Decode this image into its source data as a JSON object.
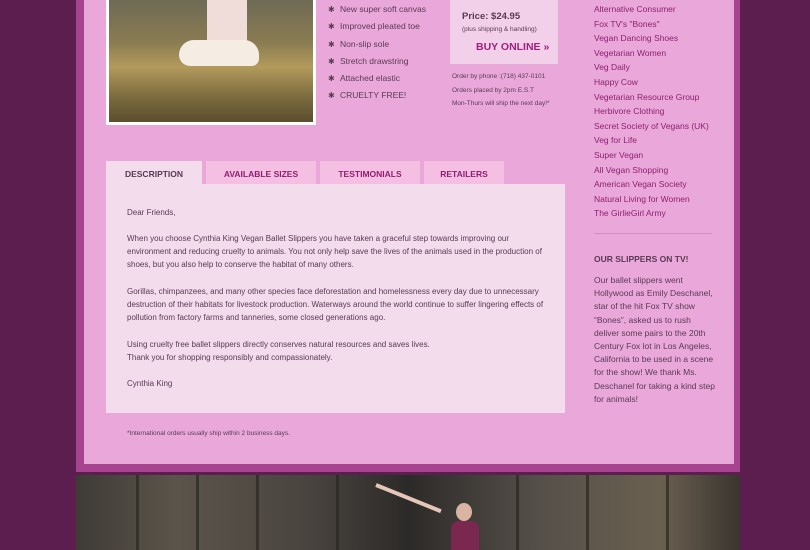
{
  "features": [
    "New super soft canvas",
    "Improved pleated toe",
    "Non-slip sole",
    "Stretch drawstring",
    "Attached elastic",
    "CRUELTY FREE!"
  ],
  "purchase": {
    "price": "Price: $24.95",
    "shipping": "(plus shipping & handling)",
    "buy_label": "BUY ONLINE »",
    "order_phone": "Order by phone :(718) 437-0101",
    "order_time": "Orders placed by 2pm E.S.T",
    "ship_days": "Mon-Thurs will ship the next day!*"
  },
  "sidebar": {
    "links": [
      "Alternative Consumer",
      "Fox TV's \"Bones\"",
      "Vegan Dancing Shoes",
      "Vegetarian Women",
      "Veg Daily",
      "Happy Cow",
      "Vegetarian Resource Group",
      "Herbivore Clothing",
      "Secret Society of Vegans (UK)",
      "Veg for Life",
      "Super Vegan",
      "All Vegan Shopping",
      "American Vegan Society",
      "Natural Living for Women",
      "The GirlieGirl Army"
    ],
    "tv_title": "OUR SLIPPERS ON TV!",
    "tv_text": "Our ballet slippers went Hollywood as Emily Deschanel, star of the hit Fox TV show “Bones”, asked us to rush deliver some pairs to the 20th Century Fox lot in Los Angeles, California to be used in a scene for the show!  We thank Ms. Deschanel for taking a kind step for animals!"
  },
  "tabs": [
    "DESCRIPTION",
    "AVAILABLE SIZES",
    "TESTIMONIALS",
    "RETAILERS"
  ],
  "description": {
    "greeting": "Dear Friends,",
    "para1": "When you choose Cynthia King Vegan Ballet Slippers you have taken a graceful step towards improving our environment and reducing cruelty to animals. You not only help save the lives of the animals used in the production of shoes, but you also help to conserve the habitat of many others.",
    "para2": "Gorillas, chimpanzees, and many other species face deforestation and homelessness every day due to unnecessary destruction of their habitats for livestock production. Waterways around the world continue to suffer lingering effects of pollution from factory farms and tanneries, some closed generations ago.",
    "para3a": "Using cruelty free ballet slippers directly conserves natural resources and saves lives.",
    "para3b": "Thank you for shopping responsibly and compassionately.",
    "signature": "Cynthia King"
  },
  "footnote": "*International orders usually ship within 2 business days."
}
